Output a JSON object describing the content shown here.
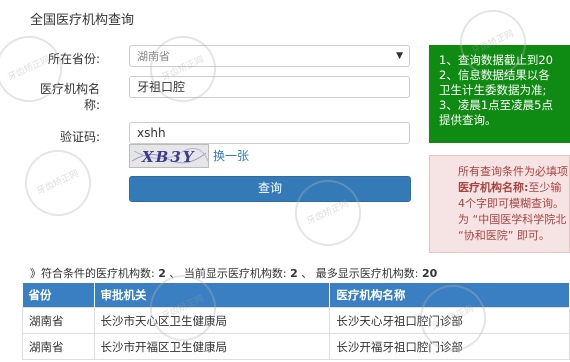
{
  "page": {
    "title": "全国医疗机构查询"
  },
  "form": {
    "province": {
      "label": "所在省份:",
      "value": "湖南省"
    },
    "institution": {
      "label_line1": "医疗机构名",
      "label_line2": "称:",
      "value": "牙祖口腔"
    },
    "captcha": {
      "label": "验证码:",
      "value": "xshh",
      "image_text": "XB3Y",
      "refresh_label": "换一张"
    },
    "submit_label": "查询"
  },
  "notices": {
    "green": [
      "1、查询数据截止到20",
      "2、信息数据结果以各",
      "卫生计生委数据为准;",
      "3、凌晨1点至凌晨5点",
      "提供查询。"
    ],
    "pink": {
      "line1": "所有查询条件为必填项",
      "line2_bold": "医疗机构名称:",
      "line2_rest": "至少输",
      "line3": "4个字即可模糊查询。",
      "line4": "为 “中国医学科学院北",
      "line5": "“协和医院” 即可。"
    }
  },
  "summary": {
    "prefix": "》符合条件的医疗机构数:",
    "matched": "2",
    "mid": "、 当前显示医疗机构数:",
    "shown": "2",
    "mid2": "、 最多显示医疗机构数:",
    "max": "20"
  },
  "table": {
    "headers": [
      "省份",
      "审批机关",
      "医疗机构名称"
    ],
    "rows": [
      [
        "湖南省",
        "长沙市天心区卫生健康局",
        "长沙天心牙祖口腔门诊部"
      ],
      [
        "湖南省",
        "长沙市开福区卫生健康局",
        "长沙开福牙祖口腔门诊部"
      ]
    ]
  },
  "watermark": {
    "text": "牙齿矫正网"
  },
  "colors": {
    "primary": "#337ab7",
    "notice_green": "#0f8a12",
    "notice_pink": "#f6e4e4",
    "table_header": "#3a7fc1"
  }
}
